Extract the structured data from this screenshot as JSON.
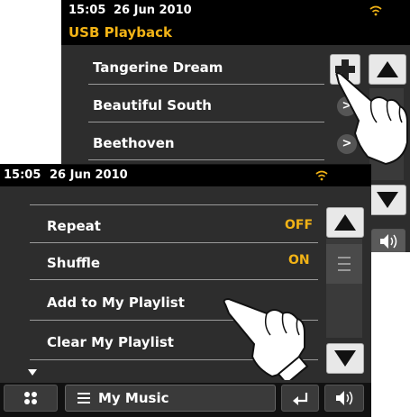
{
  "back_screen": {
    "status": {
      "time": "15:05",
      "date": "26 Jun 2010",
      "wifi_icon": "wifi-icon"
    },
    "title": "USB Playback",
    "items": [
      {
        "label": "Tangerine Dream"
      },
      {
        "label": "Beautiful South"
      },
      {
        "label": "Beethoven"
      }
    ],
    "buttons": {
      "add": "plus-icon",
      "scroll_up": "arrow-up-icon",
      "scroll_down": "arrow-down-icon",
      "volume": "volume-icon"
    }
  },
  "front_screen": {
    "status": {
      "time": "15:05",
      "date": "26 Jun 2010",
      "wifi_icon": "wifi-icon"
    },
    "items": [
      {
        "label": "Repeat",
        "value": "OFF"
      },
      {
        "label": "Shuffle",
        "value": "ON"
      },
      {
        "label": "Add to My Playlist"
      },
      {
        "label": "Clear My Playlist"
      }
    ],
    "bottom": {
      "menu_icon": "grid-menu-icon",
      "my_music": "My Music",
      "back_icon": "return-icon",
      "volume_icon": "volume-icon"
    }
  },
  "colors": {
    "accent": "#f2b316",
    "background": "#2d2d2d",
    "bar": "#000000"
  }
}
